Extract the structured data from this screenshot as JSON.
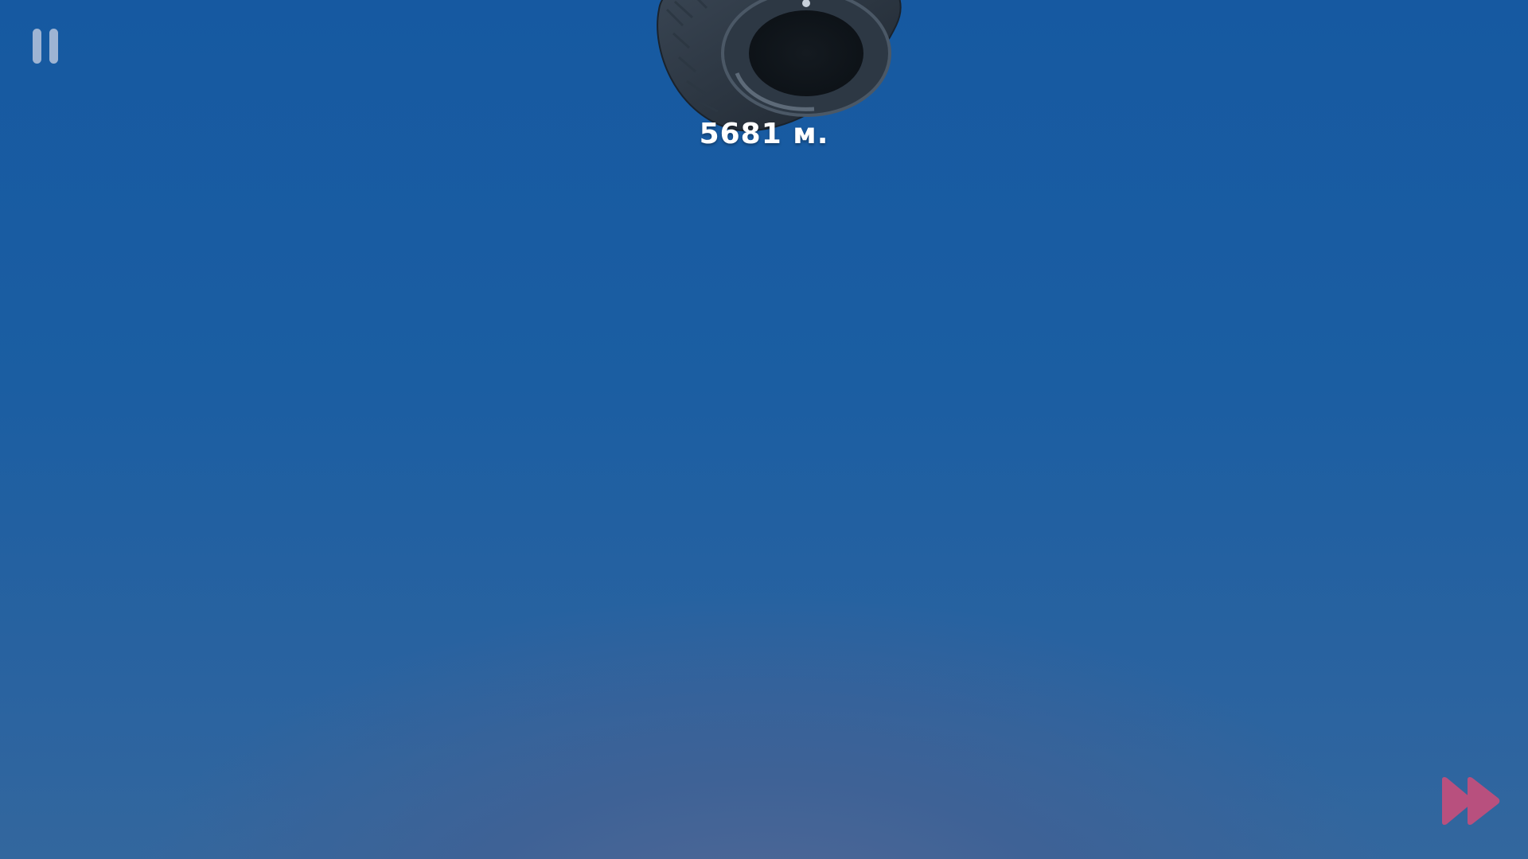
{
  "hud": {
    "pause_icon": "pause-icon",
    "distance_label": "5681 м.",
    "fast_forward_icon": "fast-forward-icon"
  },
  "scene": {
    "object": "tire-icon"
  },
  "colors": {
    "sky_top": "#1659a1",
    "sky_bottom_glow": "#566a95",
    "pause_icon": "#d2d7e6",
    "fast_forward_icon": "#b8507e",
    "distance_text": "#ffffff"
  }
}
